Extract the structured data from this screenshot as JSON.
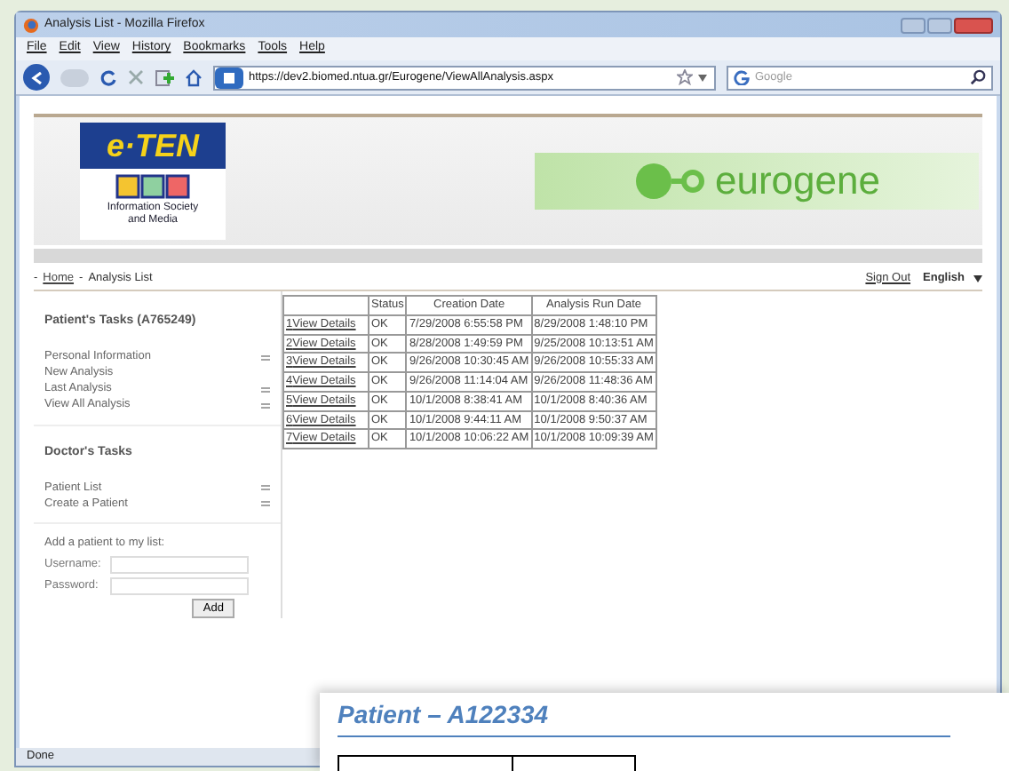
{
  "window": {
    "title": "Analysis List - Mozilla Firefox"
  },
  "menu": [
    "File",
    "Edit",
    "View",
    "History",
    "Bookmarks",
    "Tools",
    "Help"
  ],
  "address_bar": {
    "value": "https://dev2.biomed.ntua.gr/Eurogene/ViewAllAnalysis.aspx"
  },
  "search": {
    "placeholder": "Google"
  },
  "header": {
    "logo_text": "e·TEN",
    "logo_caption": "Information Society and Media",
    "banner_text": "eurogene"
  },
  "breadcrumb": {
    "items": [
      {
        "separator": "-",
        "label": "Home",
        "link": true
      },
      {
        "separator": "-",
        "label": "Analysis List",
        "link": false
      }
    ]
  },
  "sign_out": "Sign Out",
  "language": "English",
  "sidebar": {
    "sections": [
      {
        "title": "Patient's Tasks (A765249)",
        "items": [
          {
            "label": "Personal Information",
            "arrow": true
          },
          {
            "label": "New Analysis",
            "arrow": false
          },
          {
            "label": "Last Analysis",
            "arrow": true
          },
          {
            "label": "View All Analysis",
            "arrow": true
          }
        ]
      },
      {
        "title": "Doctor's Tasks",
        "items": [
          {
            "label": "Patient List",
            "arrow": true
          },
          {
            "label": "Create a Patient",
            "arrow": true
          }
        ]
      }
    ],
    "add_form": {
      "title": "Add a patient to my list:",
      "fields": [
        {
          "label": "Username:"
        },
        {
          "label": "Password:"
        }
      ],
      "button": "Add"
    }
  },
  "table": {
    "columns": [
      "",
      "Status",
      "Creation Date",
      "Analysis Run Date"
    ],
    "rows": [
      {
        "number": "1",
        "link": "View Details",
        "status": "OK",
        "created": "7/29/2008 6:55:58 PM",
        "run": "8/29/2008 1:48:10 PM"
      },
      {
        "number": "2",
        "link": "View Details",
        "status": "OK",
        "created": "8/28/2008 1:49:59 PM",
        "run": "9/25/2008 10:13:51 AM"
      },
      {
        "number": "3",
        "link": "View Details",
        "status": "OK",
        "created": "9/26/2008 10:30:45 AM",
        "run": "9/26/2008 10:55:33 AM"
      },
      {
        "number": "4",
        "link": "View Details",
        "status": "OK",
        "created": "9/26/2008 11:14:04 AM",
        "run": "9/26/2008 11:48:36 AM"
      },
      {
        "number": "5",
        "link": "View Details",
        "status": "OK",
        "created": "10/1/2008 8:38:41 AM",
        "run": "10/1/2008 8:40:36 AM"
      },
      {
        "number": "6",
        "link": "View Details",
        "status": "OK",
        "created": "10/1/2008 9:44:11 AM",
        "run": "10/1/2008 9:50:37 AM"
      },
      {
        "number": "7",
        "link": "View Details",
        "status": "OK",
        "created": "10/1/2008 10:06:22 AM",
        "run": "10/1/2008 10:09:39 AM"
      }
    ]
  },
  "status_bar": "Done",
  "document_overlay": {
    "title": "Patient – A122334"
  }
}
